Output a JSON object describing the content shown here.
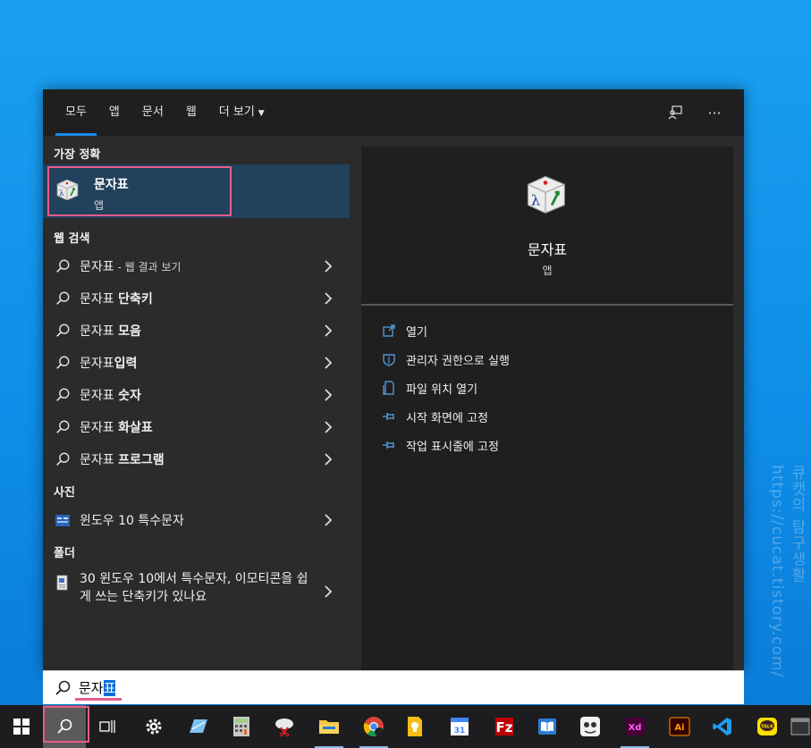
{
  "tabs": [
    {
      "label": "모두",
      "active": true
    },
    {
      "label": "앱"
    },
    {
      "label": "문서"
    },
    {
      "label": "웹"
    },
    {
      "label": "더 보기"
    }
  ],
  "best_match": {
    "section": "가장 정확",
    "title": "문자표",
    "subtitle": "앱"
  },
  "web": {
    "section": "웹 검색",
    "items": [
      {
        "query": "문자표",
        "suffix": " - 웹 결과 보기",
        "bold": ""
      },
      {
        "query": "문자표 ",
        "suffix": "",
        "bold": "단축키"
      },
      {
        "query": "문자표 ",
        "suffix": "",
        "bold": "모음"
      },
      {
        "query": "문자표",
        "suffix": "",
        "bold": "입력"
      },
      {
        "query": "문자표 ",
        "suffix": "",
        "bold": "숫자"
      },
      {
        "query": "문자표 ",
        "suffix": "",
        "bold": "화살표"
      },
      {
        "query": "문자표 ",
        "suffix": "",
        "bold": "프로그램"
      }
    ]
  },
  "photos": {
    "section": "사진",
    "item": "윈도우 10 특수문자"
  },
  "folders": {
    "section": "폴더",
    "item": "30 윈도우 10에서 특수문자, 이모티콘을 쉽게 쓰는 단축키가 있나요"
  },
  "preview": {
    "title": "문자표",
    "subtitle": "앱",
    "actions": [
      {
        "label": "열기",
        "icon": "open-icon"
      },
      {
        "label": "관리자 권한으로 실행",
        "icon": "shield-icon"
      },
      {
        "label": "파일 위치 열기",
        "icon": "file-location-icon"
      },
      {
        "label": "시작 화면에 고정",
        "icon": "pin-icon"
      },
      {
        "label": "작업 표시줄에 고정",
        "icon": "pin-icon"
      }
    ]
  },
  "search": {
    "typed": "문자",
    "selected": "표"
  },
  "watermark": "큐캣의 탐구생활 https://cucat.tistory.com/",
  "colors": {
    "accent": "#1a8be8",
    "highlight": "#e85c8a",
    "best_bg": "#21415c"
  }
}
